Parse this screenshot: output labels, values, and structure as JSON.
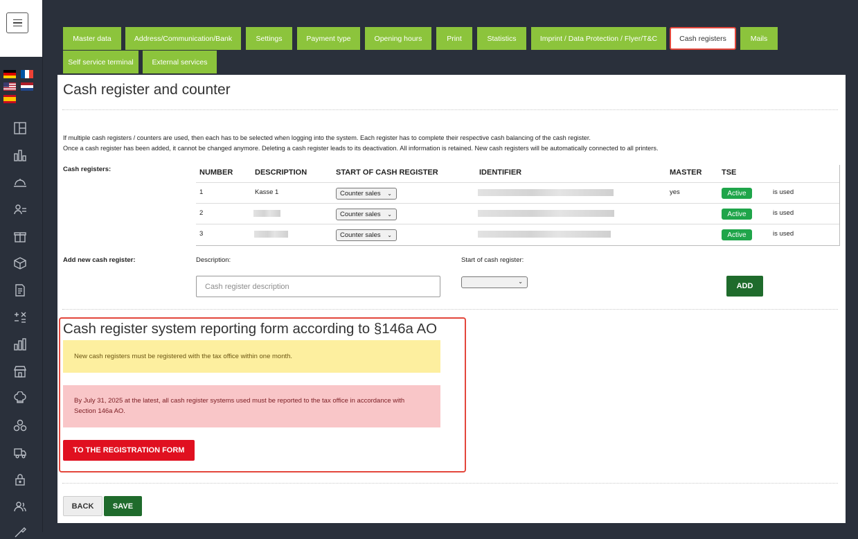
{
  "tabs": [
    {
      "label": "Master data"
    },
    {
      "label": "Address/Communication/Bank"
    },
    {
      "label": "Settings"
    },
    {
      "label": "Payment type"
    },
    {
      "label": "Opening hours"
    },
    {
      "label": "Print"
    },
    {
      "label": "Statistics"
    },
    {
      "label": "Imprint / Data Protection / Flyer/T&C"
    },
    {
      "label": "Cash registers",
      "active": true
    },
    {
      "label": "Mails"
    },
    {
      "label": "Self service terminal"
    },
    {
      "label": "External services"
    }
  ],
  "languages": [
    "German",
    "French",
    "English",
    "Dutch",
    "Spanish"
  ],
  "sidebar_icons": [
    "dashboard-icon",
    "bar-chart-icon",
    "cloche-icon",
    "customer-list-icon",
    "gift-icon",
    "box-icon",
    "invoice-icon",
    "calculator-icon",
    "statistics-icon",
    "store-icon",
    "chef-hat-icon",
    "ingredients-icon",
    "delivery-truck-icon",
    "lock-icon",
    "users-icon",
    "tools-icon"
  ],
  "page": {
    "title": "Cash register and counter",
    "info_line1": "If multiple cash registers / counters are used, then each has to be selected when logging into the system. Each register has to complete their respective cash balancing of the cash register.",
    "info_line2": "Once a cash register has been added, it cannot be changed anymore. Deleting a cash register leads to its deactivation. All information is retained. New cash registers will be automatically connected to all printers."
  },
  "registers": {
    "label": "Cash registers:",
    "columns": [
      "NUMBER",
      "DESCRIPTION",
      "START OF CASH REGISTER",
      "IDENTIFIER",
      "MASTER",
      "TSE"
    ],
    "rows": [
      {
        "number": "1",
        "description": "Kasse 1",
        "start": "Counter sales",
        "master": "yes",
        "tse": "Active",
        "status": "is used"
      },
      {
        "number": "2",
        "description": "",
        "start": "Counter sales",
        "master": "",
        "tse": "Active",
        "status": "is used"
      },
      {
        "number": "3",
        "description": "",
        "start": "Counter sales",
        "master": "",
        "tse": "Active",
        "status": "is used"
      }
    ]
  },
  "add_form": {
    "label": "Add new cash register:",
    "description_label": "Description:",
    "description_placeholder": "Cash register description",
    "start_label": "Start of cash register:",
    "add_button": "ADD"
  },
  "reporting": {
    "title": "Cash register system reporting form according to §146a AO",
    "notice": "New cash registers must be registered with the tax office within one month.",
    "deadline_line1": "By July 31, 2025 at the latest, all cash register systems used must be reported to the tax office in accordance with",
    "deadline_line2": "Section 146a AO.",
    "form_button": "TO THE REGISTRATION FORM"
  },
  "footer": {
    "back": "BACK",
    "save": "SAVE"
  },
  "colors": {
    "tab_green": "#8cc43c",
    "accent_red": "#e3463b",
    "button_green": "#1f6b2c",
    "badge_green": "#1fa54a",
    "cta_red": "#e01020"
  }
}
